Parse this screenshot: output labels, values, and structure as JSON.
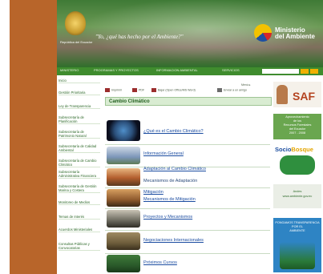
{
  "header": {
    "slogan": "\"Yo, ¿qué has hecho por el Ambiente?\"",
    "coat_label": "República del Ecuador",
    "ministry_line1": "Ministerio",
    "ministry_line2": "del Ambiente"
  },
  "nav": {
    "items": [
      "MINISTERIO",
      "PROGRAMAS Y PROYECTOS",
      "INFORMACION AMBIENTAL",
      "SERVICIOS"
    ]
  },
  "sidebar": {
    "items": [
      "Inicio",
      "Gestión Prioritaria",
      "Ley de Transparencia",
      "Subsecretaría de Planificación",
      "Subsecretaría de Patrimonio Natural",
      "Subsecretaría de Calidad Ambiental",
      "Subsecretaría de Cambio Climático",
      "Subsecretaría Administrativa Financiera",
      "Subsecretaría de Gestión Marina y Costera",
      "Monitoreo de Medios",
      "Temas de Interés",
      "Acuerdos Ministeriales",
      "Consultas Públicas y Convocatorias"
    ]
  },
  "toolbar": {
    "print": "Imprimir",
    "pdf": "PDF",
    "bajar": "Bajar (Open Office/MS Word)",
    "email": "Enviar a un amigo",
    "menu": "Menú ▸"
  },
  "main": {
    "section_title": "Cambio Climático",
    "links": [
      "¿Qué es el Cambio Climático?",
      "Información General",
      "Adaptación al Cambio Climático",
      "Mecanismos de Adaptación",
      "Mitigación",
      "Mecanismos de Mitigación",
      "Proyectos y Mecanismos",
      "Negociaciones Internacionales",
      "Próximos Cursos"
    ]
  },
  "right": {
    "saf": "SAF",
    "aprov_lines": [
      "Aprovechamiento",
      "de los",
      "Recursos Forestales",
      "del Ecuador",
      "2007 - 2008"
    ],
    "socio_a": "Socio",
    "socio_b": "Bosque",
    "andes_lines": [
      "Andes",
      "www.ambiente.gov.ec"
    ],
    "aguas_lines": [
      "PONGAMOS TRANSPARENCIA",
      "POR EL",
      "AMBIENTE"
    ]
  }
}
